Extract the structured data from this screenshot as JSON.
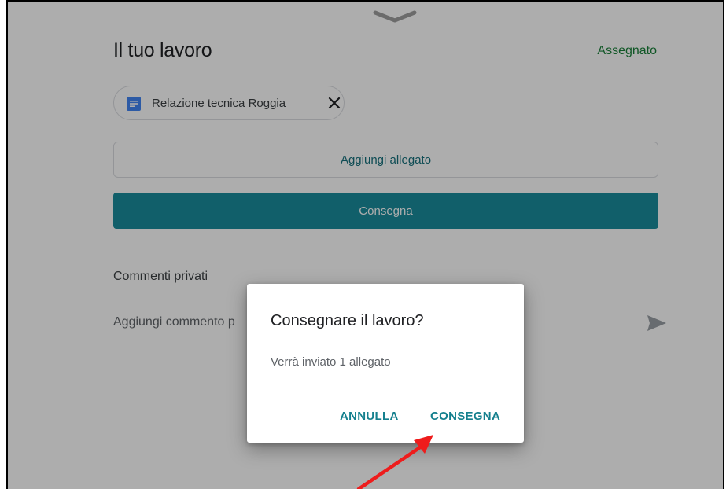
{
  "header": {
    "title": "Il tuo lavoro",
    "status": "Assegnato"
  },
  "attachment": {
    "name": "Relazione tecnica Roggia",
    "icon": "document-icon",
    "remove_icon": "close-icon"
  },
  "actions": {
    "add_attachment_label": "Aggiungi allegato",
    "submit_label": "Consegna"
  },
  "private_comments": {
    "title": "Commenti privati",
    "placeholder": "Aggiungi commento p",
    "send_icon": "send-icon"
  },
  "dialog": {
    "title": "Consegnare il lavoro?",
    "body": "Verrà inviato 1 allegato",
    "cancel_label": "ANNULLA",
    "confirm_label": "CONSEGNA"
  },
  "colors": {
    "accent": "#1a8d9c",
    "status_green": "#188038",
    "annotation_arrow": "#ee1c1c"
  }
}
